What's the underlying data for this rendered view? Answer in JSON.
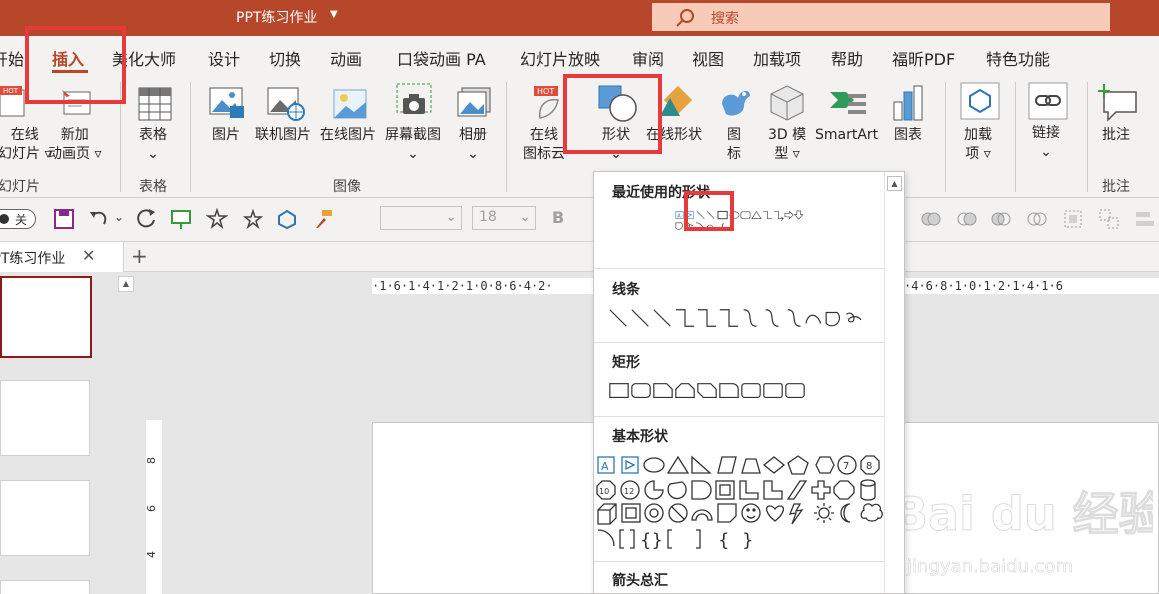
{
  "window": {
    "doc_title": "PPT练习作业",
    "search_label": "搜索"
  },
  "tabs": [
    {
      "label": "开始"
    },
    {
      "label": "插入"
    },
    {
      "label": "美化大师"
    },
    {
      "label": "设计"
    },
    {
      "label": "切换"
    },
    {
      "label": "动画"
    },
    {
      "label": "口袋动画 PA"
    },
    {
      "label": "幻灯片放映"
    },
    {
      "label": "审阅"
    },
    {
      "label": "视图"
    },
    {
      "label": "加载项"
    },
    {
      "label": "帮助"
    },
    {
      "label": "福昕PDF"
    },
    {
      "label": "特色功能"
    }
  ],
  "ribbon": {
    "slides": {
      "online_1": "在线",
      "online_2": "幻灯片 ▿",
      "new_anim_1": "新加",
      "new_anim_2": "动画页 ▿",
      "group": "幻灯片"
    },
    "tables": {
      "table": "表格",
      "group": "表格"
    },
    "images": {
      "picture": "图片",
      "linked": "联机图片",
      "online": "在线图片",
      "screenshot": "屏幕截图",
      "album": "相册",
      "group": "图像"
    },
    "illus": {
      "online_icon_1": "在线",
      "online_icon_2": "图标云",
      "shapes": "形状",
      "online_shapes": "在线形状",
      "icon_1": "图",
      "icon_2": "标",
      "model_1": "3D 模",
      "model_2": "型 ▿",
      "smartart": "SmartArt",
      "chart": "图表"
    },
    "addins": {
      "label_1": "加载",
      "label_2": "项 ▿"
    },
    "links": {
      "label": "链接"
    },
    "comments": {
      "label": "批注",
      "group": "批注"
    }
  },
  "qat": {
    "toggle_label": "关",
    "font_size": "18",
    "bold": "B"
  },
  "doc_tab": {
    "title": "PPT练习作业",
    "close": "✕",
    "add": "+"
  },
  "ruler": {
    "h_left": "·1·6·1·4·1·2·1·0·8·6·4·2·",
    "h_right": "·4·6·8·1·0·1·2·1·4·1·6"
  },
  "ruler_v": [
    "8",
    "6",
    "4"
  ],
  "dropdown": {
    "recent": "最近使用的形状",
    "lines": "线条",
    "rect": "矩形",
    "basic": "基本形状",
    "arrows": "箭头总汇",
    "badges": [
      "7",
      "8",
      "10",
      "12"
    ]
  },
  "watermark": {
    "brand": "Bai du 经验",
    "url": "jingyan.baidu.com"
  },
  "colors": {
    "accent": "#b7472a",
    "highlight": "#e83a3a",
    "ribbon_bg": "#f3f2f1"
  }
}
